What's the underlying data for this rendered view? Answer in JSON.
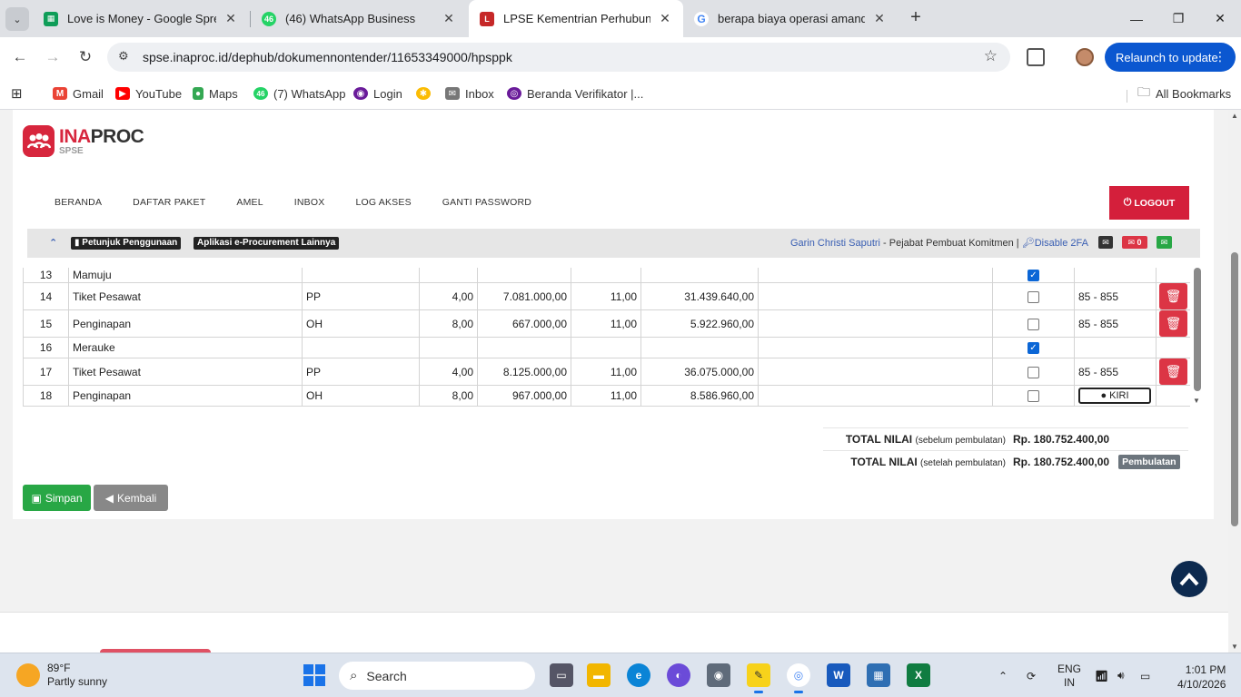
{
  "browser": {
    "tabs": [
      {
        "title": "Love is Money - Google Spread",
        "icon": "sheets-icon",
        "color": "#0f9d58"
      },
      {
        "title": "(46) WhatsApp Business",
        "icon": "whatsapp-icon",
        "color": "#25d366",
        "badge": "46"
      },
      {
        "title": "LPSE Kementrian Perhubungan",
        "icon": "lpse-icon",
        "color": "#c62828"
      },
      {
        "title": "berapa biaya operasi amandel -",
        "icon": "google-icon",
        "color": "#4285f4"
      }
    ],
    "url": "spse.inaproc.id/dephub/dokumennontender/11653349000/hpsppk",
    "relaunch_label": "Relaunch to update",
    "bookmarks": [
      {
        "label": "Gmail",
        "icon": "gmail-icon",
        "color": "#ea4335"
      },
      {
        "label": "YouTube",
        "icon": "youtube-icon",
        "color": "#ff0000"
      },
      {
        "label": "Maps",
        "icon": "maps-icon",
        "color": "#34a853"
      },
      {
        "label": "(7) WhatsApp",
        "icon": "whatsapp-icon",
        "color": "#25d366",
        "badge": "46"
      },
      {
        "label": "Login",
        "icon": "login-icon",
        "color": "#6a1b9a"
      },
      {
        "label": "",
        "icon": "pinwheel-icon",
        "color": "#fbbc04"
      },
      {
        "label": "Inbox",
        "icon": "inbox-icon",
        "color": "#777777"
      },
      {
        "label": "Beranda Verifikator |...",
        "icon": "verifikator-icon",
        "color": "#6a1b9a"
      }
    ],
    "all_bookmarks_label": "All Bookmarks"
  },
  "site": {
    "logo": {
      "ina": "INA",
      "proc": "PROC",
      "sub": "SPSE"
    },
    "nav": [
      "BERANDA",
      "DAFTAR PAKET",
      "AMEL",
      "INBOX",
      "LOG AKSES",
      "GANTI PASSWORD"
    ],
    "logout_label": "LOGOUT",
    "info": {
      "petunjuk": "Petunjuk Penggunaan",
      "aplikasi": "Aplikasi e-Procurement Lainnya",
      "user_name": "Garin Christi Saputri",
      "user_role": " - Pejabat Pembuat Komitmen | ",
      "disable_2fa": "Disable 2FA",
      "mail_count": "0"
    },
    "colors": {
      "brand_red": "#d41f3b",
      "success": "#28a745",
      "secondary": "#888888",
      "navy": "#0d2a4f"
    }
  },
  "table": {
    "rows": [
      {
        "no": "13",
        "uraian": "Mamuju",
        "satuan": "",
        "vol": "",
        "harga": "",
        "pajak": "",
        "total": "",
        "ket": "",
        "checked": true,
        "kode": "",
        "action": "none"
      },
      {
        "no": "14",
        "uraian": "Tiket Pesawat",
        "satuan": "PP",
        "vol": "4,00",
        "harga": "7.081.000,00",
        "pajak": "11,00",
        "total": "31.439.640,00",
        "ket": "",
        "checked": false,
        "kode": "85 - 855",
        "action": "delete"
      },
      {
        "no": "15",
        "uraian": "Penginapan",
        "satuan": "OH",
        "vol": "8,00",
        "harga": "667.000,00",
        "pajak": "11,00",
        "total": "5.922.960,00",
        "ket": "",
        "checked": false,
        "kode": "85 - 855",
        "action": "delete"
      },
      {
        "no": "16",
        "uraian": "Merauke",
        "satuan": "",
        "vol": "",
        "harga": "",
        "pajak": "",
        "total": "",
        "ket": "",
        "checked": true,
        "kode": "",
        "action": "none"
      },
      {
        "no": "17",
        "uraian": "Tiket Pesawat",
        "satuan": "PP",
        "vol": "4,00",
        "harga": "8.125.000,00",
        "pajak": "11,00",
        "total": "36.075.000,00",
        "ket": "",
        "checked": false,
        "kode": "85 - 855",
        "action": "delete"
      },
      {
        "no": "18",
        "uraian": "Penginapan",
        "satuan": "OH",
        "vol": "8,00",
        "harga": "967.000,00",
        "pajak": "11,00",
        "total": "8.586.960,00",
        "ket": "",
        "checked": false,
        "kode": "",
        "action": "kirim"
      }
    ],
    "kirim_label": "KIRI"
  },
  "totals": {
    "before_label": "TOTAL NILAI",
    "before_note": "(sebelum pembulatan)",
    "before_value": "Rp. 180.752.400,00",
    "after_label": "TOTAL NILAI",
    "after_note": "(setelah pembulatan)",
    "after_value": "Rp. 180.752.400,00",
    "pembulatan_label": "Pembulatan"
  },
  "buttons": {
    "simpan": "Simpan",
    "kembali": "Kembali"
  },
  "taskbar": {
    "temp": "89°F",
    "weather": "Partly sunny",
    "search_placeholder": "Search",
    "lang1": "ENG",
    "lang2": "IN",
    "time": "1:01 PM",
    "date": "4/10/2026"
  }
}
